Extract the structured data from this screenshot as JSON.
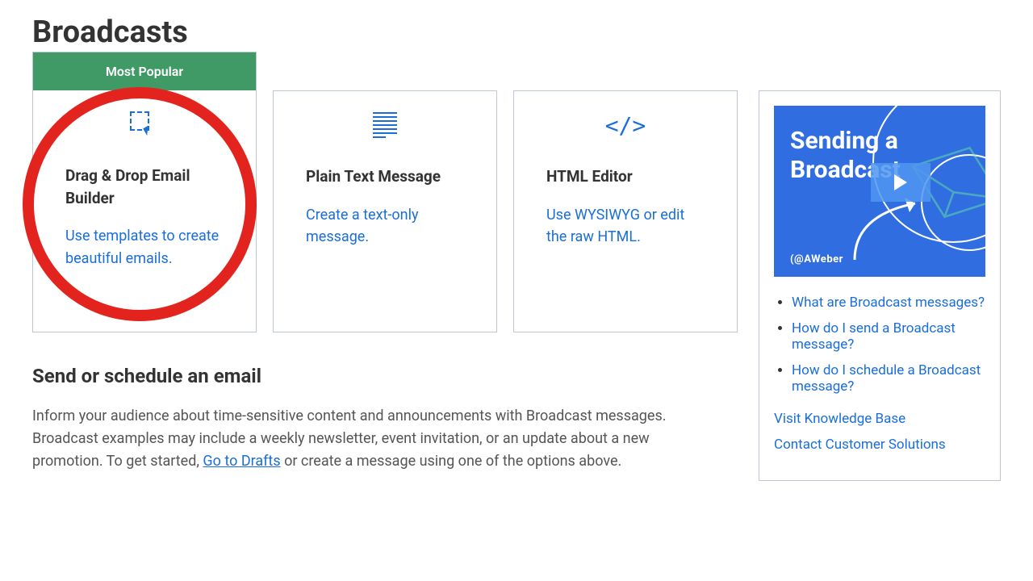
{
  "header": {
    "title": "Broadcasts"
  },
  "cards": [
    {
      "badge": "Most Popular",
      "title": "Drag & Drop Email Builder",
      "desc": "Use templates to create beautiful emails.",
      "icon": "drag-drop-icon"
    },
    {
      "title": "Plain Text Message",
      "desc": "Create a text-only message.",
      "icon": "plain-text-icon"
    },
    {
      "title": "HTML Editor",
      "desc": "Use WYSIWYG or edit the raw HTML.",
      "icon": "html-icon"
    }
  ],
  "section": {
    "heading": "Send or schedule an email",
    "text_before": "Inform your audience about time-sensitive content and announcements with Broadcast messages. Broadcast examples may include a weekly newsletter, event invitation, or an update about a new promotion. To get started, ",
    "link": "Go to Drafts",
    "text_after": " or create a message using one of the options above."
  },
  "sidebar": {
    "video_title": "Sending a Broadcast",
    "brand": "(@AWeber",
    "help_title_items": [
      "What are Broadcast messages?",
      "How do I send a Broadcast message?",
      "How do I schedule a Broadcast message?"
    ],
    "links": [
      "Visit Knowledge Base",
      "Contact Customer Solutions"
    ]
  },
  "colors": {
    "green": "#3f9a66",
    "blue_link": "#1a6ed8",
    "border": "#bfc7d1",
    "annotation_red": "#e3241e"
  }
}
